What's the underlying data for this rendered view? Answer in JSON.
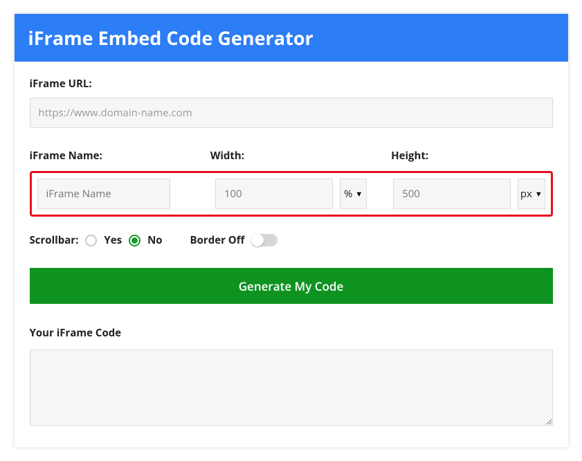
{
  "header": {
    "title": "iFrame Embed Code Generator"
  },
  "url": {
    "label": "iFrame URL:",
    "placeholder": "https://www.domain-name.com",
    "value": ""
  },
  "name": {
    "label": "iFrame Name:",
    "placeholder": "iFrame Name",
    "value": ""
  },
  "width": {
    "label": "Width:",
    "value": "100",
    "unit": "%"
  },
  "height": {
    "label": "Height:",
    "value": "500",
    "unit": "px"
  },
  "scrollbar": {
    "label": "Scrollbar:",
    "yes": "Yes",
    "no": "No",
    "selected": "No"
  },
  "border": {
    "label": "Border Off",
    "on": false
  },
  "generate": {
    "label": "Generate My Code"
  },
  "output": {
    "label": "Your iFrame Code",
    "value": ""
  }
}
